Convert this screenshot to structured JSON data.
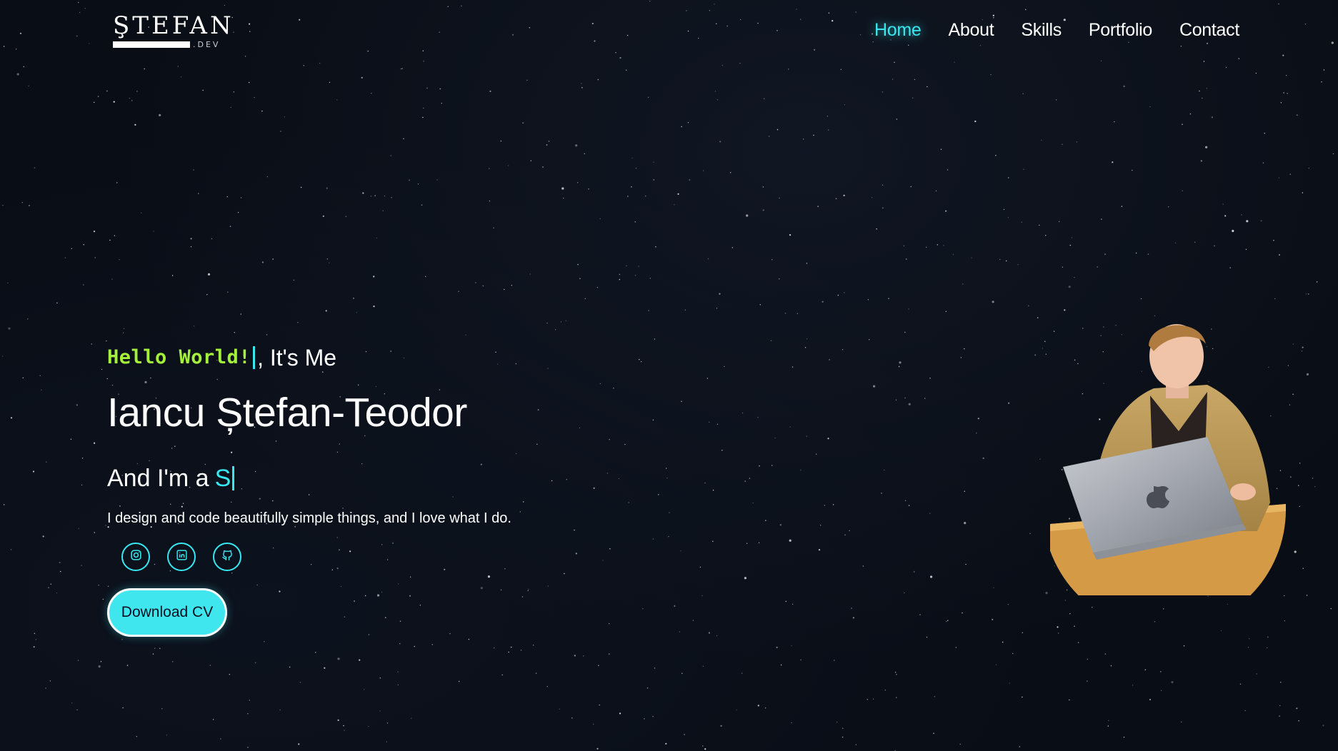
{
  "logo": {
    "title": "ŞTEFAN",
    "suffix": ".DEV"
  },
  "nav": {
    "items": [
      {
        "label": "Home",
        "active": true
      },
      {
        "label": "About",
        "active": false
      },
      {
        "label": "Skills",
        "active": false
      },
      {
        "label": "Portfolio",
        "active": false
      },
      {
        "label": "Contact",
        "active": false
      }
    ]
  },
  "hero": {
    "greeting_typed": "Hello World!",
    "greeting_rest": ", It's Me",
    "name": "Iancu Ștefan-Teodor",
    "role_prefix": "And I'm a",
    "role_typed": "S",
    "tagline": "I design and code beautifully simple things, and I love what I do.",
    "cta_label": "Download CV"
  },
  "socials": [
    {
      "icon": "instagram-icon"
    },
    {
      "icon": "linkedin-icon"
    },
    {
      "icon": "github-icon"
    }
  ],
  "colors": {
    "accent": "#38e8f0",
    "greeting": "#a4f03a",
    "background": "#090d15"
  }
}
